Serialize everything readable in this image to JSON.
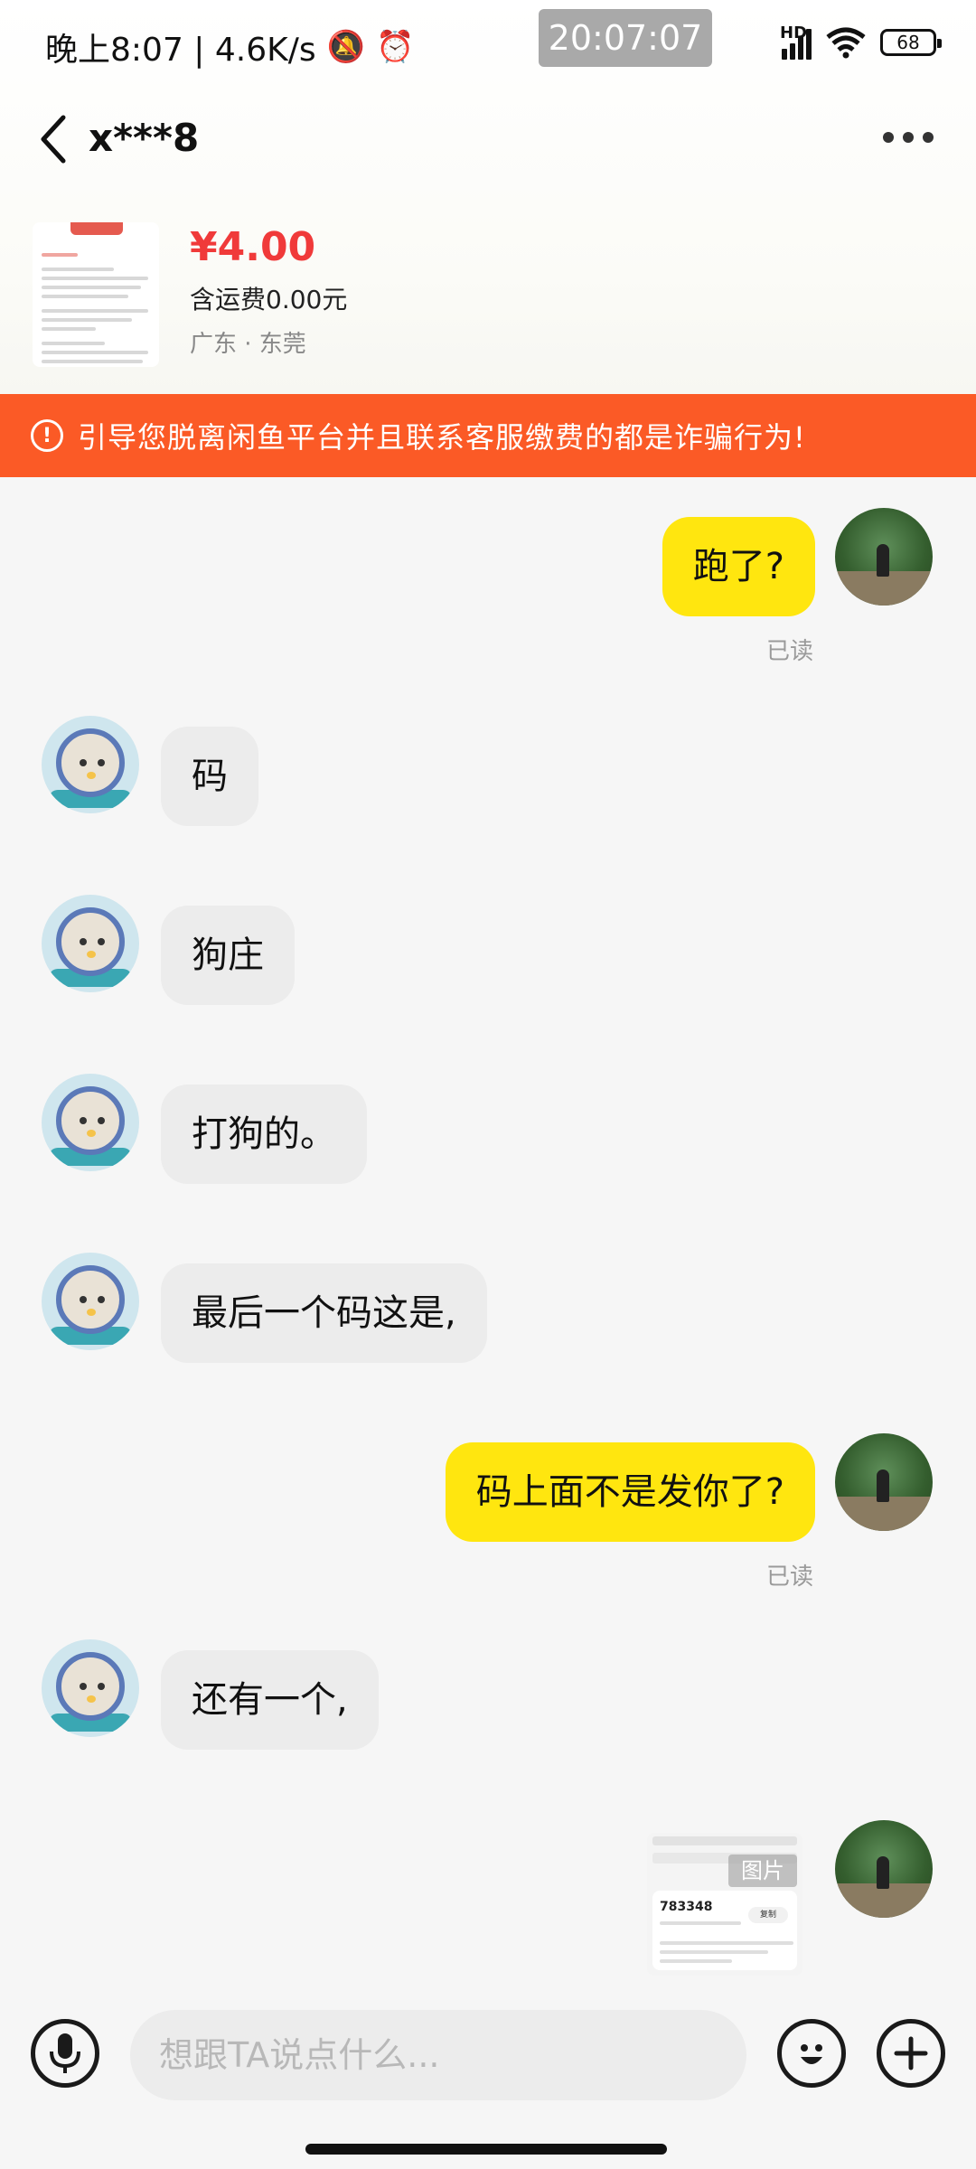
{
  "status_bar": {
    "left_text": "晚上8:07 | 4.6K/s",
    "overlay_time": "20:07:07",
    "network": "HD",
    "battery": "68"
  },
  "header": {
    "title": "x***8"
  },
  "product": {
    "price": "¥4.00",
    "shipping": "含运费0.00元",
    "location": "广东 · 东莞"
  },
  "warning": {
    "text": "引导您脱离闲鱼平台并且联系客服缴费的都是诈骗行为!"
  },
  "messages": [
    {
      "from": "self",
      "text": "跑了?",
      "status": "已读"
    },
    {
      "from": "other",
      "text": "码"
    },
    {
      "from": "other",
      "text": "狗庄"
    },
    {
      "from": "other",
      "text": "打狗的。"
    },
    {
      "from": "other",
      "text": "最后一个码这是,"
    },
    {
      "from": "self",
      "text": "码上面不是发你了?",
      "status": "已读"
    },
    {
      "from": "other",
      "text": "还有一个,"
    },
    {
      "from": "self",
      "type": "image",
      "label": "图片",
      "code": "783348",
      "copy": "复制"
    }
  ],
  "input": {
    "placeholder": "想跟TA说点什么..."
  },
  "icons": {
    "back": "back-arrow-icon",
    "more": "more-dots-icon",
    "warning": "info-icon",
    "voice": "microphone-icon",
    "emoji": "smile-icon",
    "add": "plus-icon"
  },
  "colors": {
    "accent_price": "#f03a3a",
    "warning_bg": "#fb5a26",
    "self_bubble": "#ffe60f",
    "other_bubble": "#ececec"
  }
}
